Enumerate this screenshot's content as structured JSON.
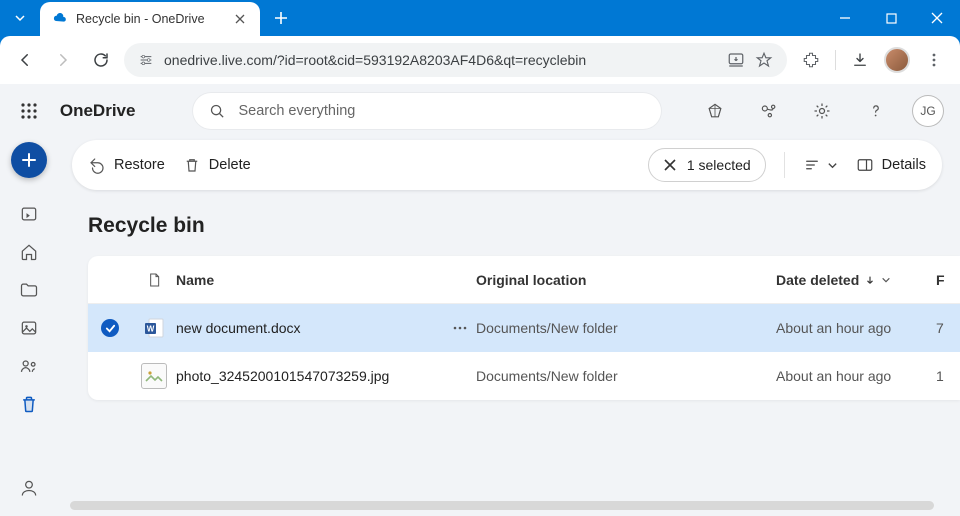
{
  "tab": {
    "title": "Recycle bin - OneDrive"
  },
  "url": "onedrive.live.com/?id=root&cid=593192A8203AF4D6&qt=recyclebin",
  "brand": "OneDrive",
  "search": {
    "placeholder": "Search everything"
  },
  "user_initials": "JG",
  "commands": {
    "restore": "Restore",
    "delete": "Delete",
    "selected_count": "1 selected",
    "details": "Details"
  },
  "page_title": "Recycle bin",
  "columns": {
    "name": "Name",
    "location": "Original location",
    "deleted": "Date deleted",
    "f": "F"
  },
  "rows": [
    {
      "selected": true,
      "icon": "word",
      "name": "new document.docx",
      "location": "Documents/New folder",
      "deleted": "About an hour ago",
      "f": "7"
    },
    {
      "selected": false,
      "icon": "image",
      "name": "photo_3245200101547073259.jpg",
      "location": "Documents/New folder",
      "deleted": "About an hour ago",
      "f": "1"
    }
  ]
}
